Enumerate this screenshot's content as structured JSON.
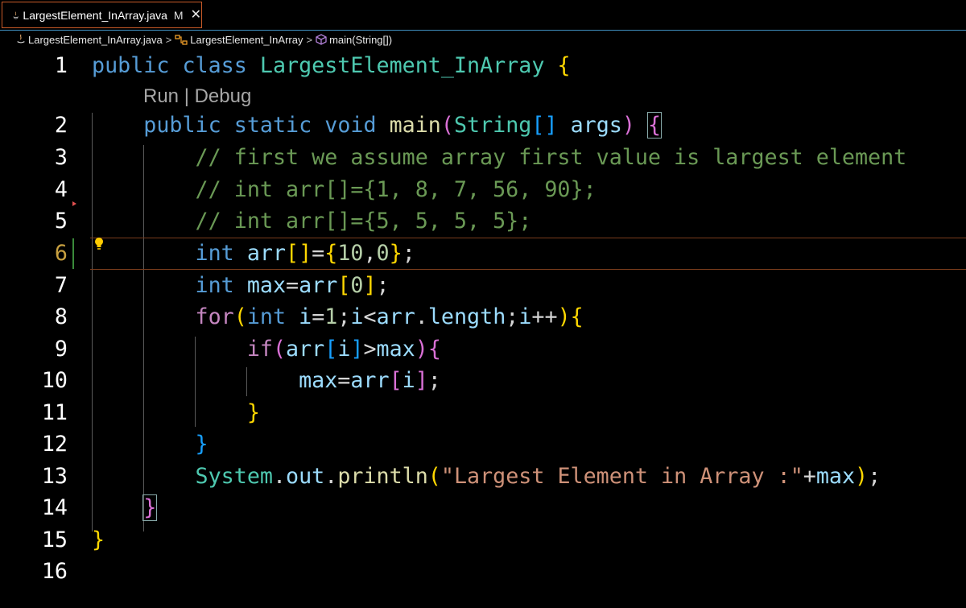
{
  "tab": {
    "filename": "LargestElement_InArray.java",
    "status": "M",
    "close": "✕"
  },
  "breadcrumb": {
    "file": "LargestElement_InArray.java",
    "class": "LargestElement_InArray",
    "method": "main(String[])"
  },
  "codelens": "Run | Debug",
  "lines": [
    "1",
    "2",
    "3",
    "4",
    "5",
    "6",
    "7",
    "8",
    "9",
    "10",
    "11",
    "12",
    "13",
    "14",
    "15",
    "16"
  ],
  "code": {
    "l1": {
      "kw1": "public",
      "kw2": "class",
      "name": "LargestElement_InArray",
      "brace": "{"
    },
    "l2": {
      "kw1": "public",
      "kw2": "static",
      "kw3": "void",
      "fn": "main",
      "p1": "(",
      "type": "String",
      "arr": "[]",
      "param": "args",
      "p2": ")",
      "brace": "{"
    },
    "l3": "// first we assume array first value is largest element",
    "l4": "// int arr[]={1, 8, 7, 56, 90};",
    "l5": "// int arr[]={5, 5, 5, 5};",
    "l6": {
      "kw": "int",
      "var": "arr",
      "arr": "[]",
      "eq": "=",
      "ob": "{",
      "n1": "10",
      "comma": ",",
      "n2": "0",
      "cb": "}",
      "semi": ";"
    },
    "l7": {
      "kw": "int",
      "var": "max",
      "eq": "=",
      "var2": "arr",
      "ob": "[",
      "n": "0",
      "cb": "]",
      "semi": ";"
    },
    "l8": {
      "kw": "for",
      "p1": "(",
      "t": "int",
      "v1": "i",
      "eq": "=",
      "n1": "1",
      "s1": ";",
      "v2": "i",
      "lt": "<",
      "v3": "arr",
      "dot": ".",
      "v4": "length",
      "s2": ";",
      "v5": "i",
      "pp": "++",
      "p2": ")",
      "brace": "{"
    },
    "l9": {
      "kw": "if",
      "p1": "(",
      "v1": "arr",
      "ob": "[",
      "v2": "i",
      "cb": "]",
      "gt": ">",
      "v3": "max",
      "p2": ")",
      "brace": "{"
    },
    "l10": {
      "v1": "max",
      "eq": "=",
      "v2": "arr",
      "ob": "[",
      "v3": "i",
      "cb": "]",
      "semi": ";"
    },
    "l11": "}",
    "l12": "}",
    "l13": {
      "t": "System",
      "d1": ".",
      "v": "out",
      "d2": ".",
      "fn": "println",
      "p1": "(",
      "str": "\"Largest Element in Array :\"",
      "plus": "+",
      "v2": "max",
      "p2": ")",
      "semi": ";"
    },
    "l14": "}",
    "l15": "}"
  },
  "colors": {
    "background": "#000000",
    "tab_border": "#c85a28",
    "keyword": "#569cd6",
    "control": "#c586c0",
    "type": "#4ec9b0",
    "function": "#dcdcaa",
    "variable": "#9cdcfe",
    "number": "#b5cea8",
    "string": "#ce9178",
    "comment": "#6a9955"
  },
  "icons": {
    "tab": "java-file-icon",
    "breadcrumb_class": "class-icon",
    "breadcrumb_method": "method-cube-icon",
    "lightbulb": "lightbulb-icon"
  }
}
